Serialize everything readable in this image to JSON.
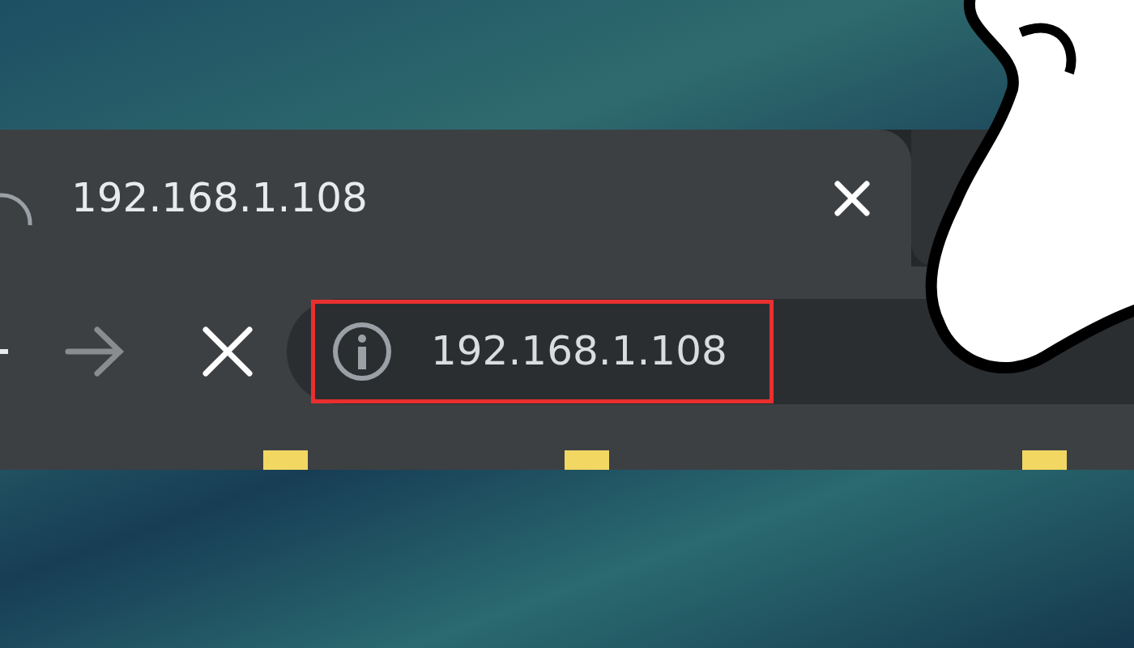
{
  "tab": {
    "title": "192.168.1.108",
    "loading": true
  },
  "toolbar": {
    "forward_disabled": true
  },
  "address_bar": {
    "url": "192.168.1.108",
    "highlighted": true
  }
}
